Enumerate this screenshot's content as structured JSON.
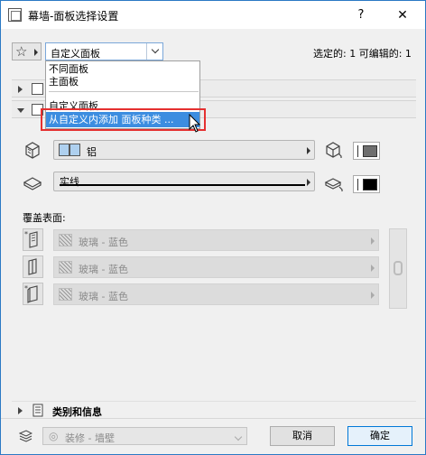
{
  "window": {
    "title": "幕墙-面板选择设置",
    "help_label": "?",
    "close_label": "✕"
  },
  "toolbar": {
    "favorites_icon": "star-icon",
    "preset_value": "自定义面板",
    "selected_info": "选定的: 1 可编辑的: 1"
  },
  "dropdown": {
    "items": [
      "不同面板",
      "主面板",
      "自定义面板"
    ],
    "add_item": "从自定义内添加 面板种类 ..."
  },
  "panels": {
    "header1_label": "",
    "header2_label": "",
    "category_label": "类别和信息"
  },
  "frame": {
    "material_label": "铝",
    "line_label": "实线"
  },
  "surfaces": {
    "section_label": "覆盖表面:",
    "rows": [
      {
        "label": "玻璃 - 蓝色"
      },
      {
        "label": "玻璃 - 蓝色"
      },
      {
        "label": "玻璃 - 蓝色"
      }
    ]
  },
  "footer": {
    "layer_label": "装修 - 墙壁",
    "cancel_label": "取消",
    "ok_label": "确定"
  },
  "colors": {
    "accent": "#0078d7",
    "highlight": "#3c8de0",
    "callout": "#e53030"
  }
}
